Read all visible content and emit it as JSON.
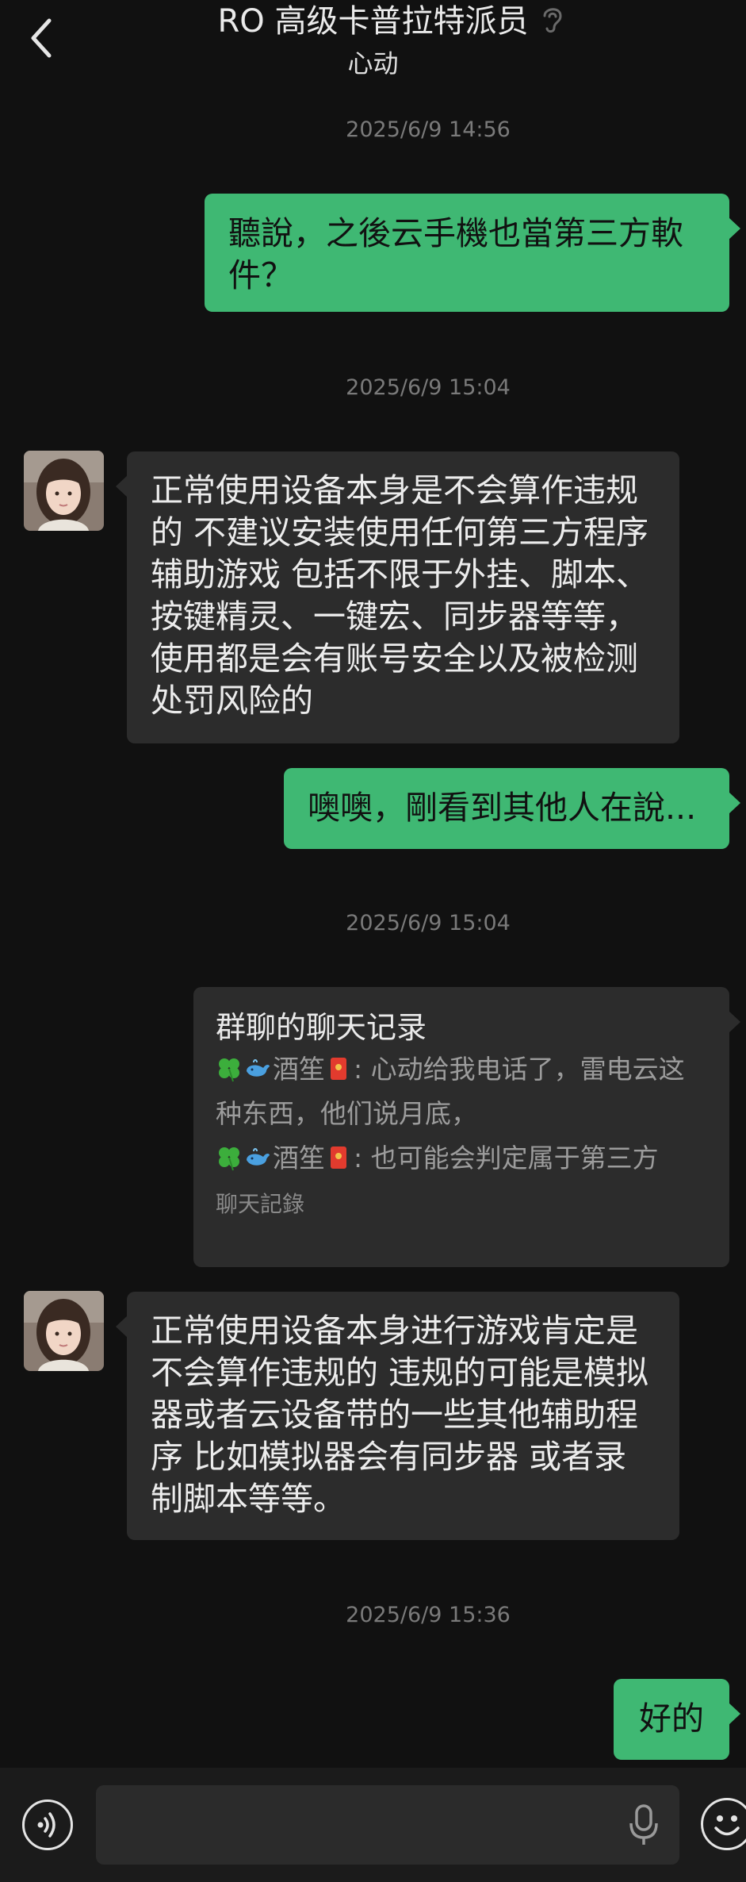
{
  "header": {
    "title": "RO 高级卡普拉特派员",
    "subtitle": "心动",
    "back_icon": "chevron-left-icon",
    "ear_icon": "ear-icon"
  },
  "messages": {
    "ts1": "2025/6/9 14:56",
    "m1_out": "聽說，之後云手機也當第三方軟件？",
    "ts2": "2025/6/9 15:04",
    "m2_in": "正常使用设备本身是不会算作违规的 不建议安装使用任何第三方程序辅助游戏 包括不限于外挂、脚本、按键精灵、一键宏、同步器等等，使用都是会有账号安全以及被检测处罚风险的",
    "m3_out": "噢噢，剛看到其他人在說...",
    "ts3": "2025/6/9 15:04",
    "record": {
      "title": "群聊的聊天记录",
      "line1_name": "酒笙",
      "line1_text": ": 心动给我电话了，雷电云这种东西，他们说月底，",
      "line2_name": "酒笙",
      "line2_text": ": 也可能会判定属于第三方",
      "footer": "聊天記錄"
    },
    "m4_in": "正常使用设备本身进行游戏肯定是不会算作违规的 违规的可能是模拟器或者云设备带的一些其他辅助程序 比如模拟器会有同步器 或者录制脚本等等。",
    "ts4": "2025/6/9 15:36",
    "m5_out": "好的"
  },
  "input_bar": {
    "placeholder": "",
    "voice_icon": "voice-icon",
    "mic_icon": "microphone-icon",
    "emoji_icon": "emoji-icon"
  },
  "colors": {
    "background": "#111111",
    "outgoing_bubble": "#3fb873",
    "incoming_bubble": "#2c2c2c",
    "timestamp": "#7a7a7a"
  }
}
